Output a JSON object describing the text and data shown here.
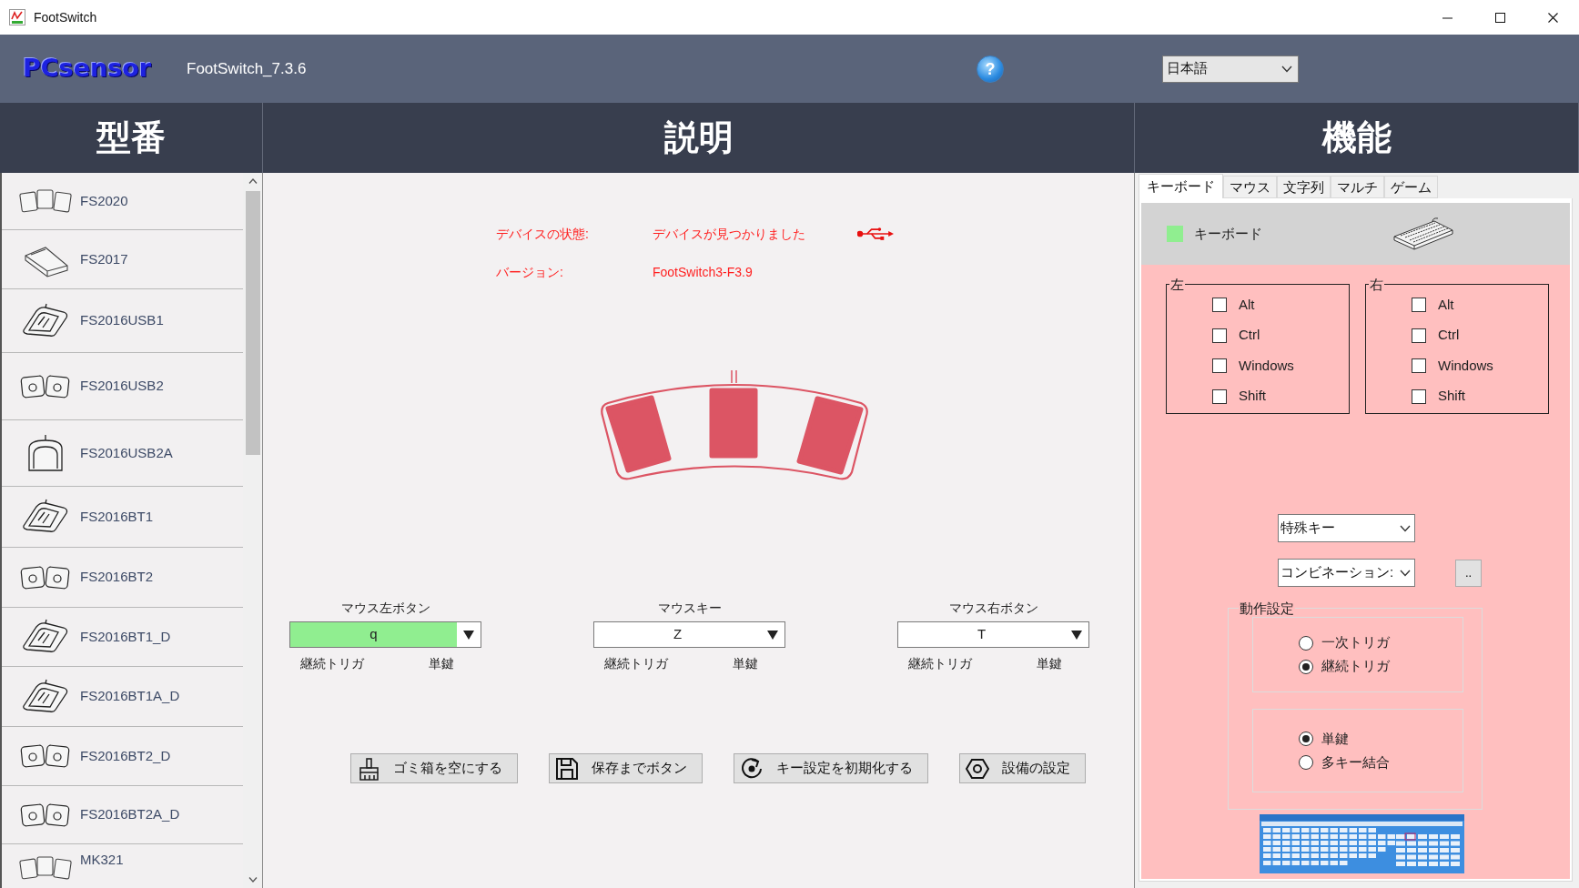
{
  "window": {
    "title": "FootSwitch"
  },
  "header": {
    "logo": "PCsensor",
    "version": "FootSwitch_7.3.6",
    "help": "?",
    "language": "日本語"
  },
  "column_titles": [
    "型番",
    "説明",
    "機能"
  ],
  "models": [
    {
      "name": "FS2020",
      "kind": "triple",
      "selected": false
    },
    {
      "name": "FS2017",
      "kind": "wedge",
      "selected": false
    },
    {
      "name": "FS2016USB1",
      "kind": "single",
      "selected": false
    },
    {
      "name": "FS2016USB2",
      "kind": "double",
      "selected": false
    },
    {
      "name": "FS2016USB2A",
      "kind": "arched",
      "selected": false
    },
    {
      "name": "FS2016BT1",
      "kind": "single",
      "selected": false
    },
    {
      "name": "FS2016BT2",
      "kind": "double",
      "selected": false
    },
    {
      "name": "FS2016BT1_D",
      "kind": "single",
      "selected": false
    },
    {
      "name": "FS2016BT1A_D",
      "kind": "single",
      "selected": false
    },
    {
      "name": "FS2016BT2_D",
      "kind": "double",
      "selected": false
    },
    {
      "name": "FS2016BT2A_D",
      "kind": "double",
      "selected": false
    },
    {
      "name": "MK321",
      "kind": "triple",
      "selected": false
    }
  ],
  "device": {
    "status_label": "デバイスの状態:",
    "status": "デバイスが見つかりました",
    "version_label": "バージョン:",
    "version": "FootSwitch3-F3.9"
  },
  "pedals": [
    {
      "label": "マウス左ボタン",
      "value": "q",
      "selected": true,
      "trigger": "継続トリガ",
      "key_mode": "単鍵"
    },
    {
      "label": "マウスキー",
      "value": "Z",
      "selected": false,
      "trigger": "継続トリガ",
      "key_mode": "単鍵"
    },
    {
      "label": "マウス右ボタン",
      "value": "T",
      "selected": false,
      "trigger": "継続トリガ",
      "key_mode": "単鍵"
    }
  ],
  "actions": [
    {
      "kind": "brush",
      "label": "ゴミ箱を空にする"
    },
    {
      "kind": "save",
      "label": "保存までボタン"
    },
    {
      "kind": "reset",
      "label": "キー設定を初期化する"
    },
    {
      "kind": "nut",
      "label": "設備の設定"
    }
  ],
  "function_tabs": [
    {
      "label": "キーボード",
      "selected": true
    },
    {
      "label": "マウス",
      "selected": false
    },
    {
      "label": "文字列",
      "selected": false
    },
    {
      "label": "マルチ",
      "selected": false
    },
    {
      "label": "ゲーム",
      "selected": false
    }
  ],
  "keyboard": {
    "title": "キーボード",
    "groups": [
      {
        "title": "左",
        "modifiers": [
          {
            "label": "Alt",
            "checked": false
          },
          {
            "label": "Ctrl",
            "checked": false
          },
          {
            "label": "Windows",
            "checked": false
          },
          {
            "label": "Shift",
            "checked": false
          }
        ]
      },
      {
        "title": "右",
        "modifiers": [
          {
            "label": "Alt",
            "checked": false
          },
          {
            "label": "Ctrl",
            "checked": false
          },
          {
            "label": "Windows",
            "checked": false
          },
          {
            "label": "Shift",
            "checked": false
          }
        ]
      }
    ],
    "special_key": "特殊キー",
    "combination": "コンビネーション:",
    "more_button": "..",
    "mode": {
      "title": "動作設定",
      "trigger_options": [
        {
          "label": "一次トリガ",
          "selected": false
        },
        {
          "label": "継続トリガ",
          "selected": true
        }
      ],
      "key_options": [
        {
          "label": "単鍵",
          "selected": true
        },
        {
          "label": "多キー結合",
          "selected": false
        }
      ]
    }
  }
}
